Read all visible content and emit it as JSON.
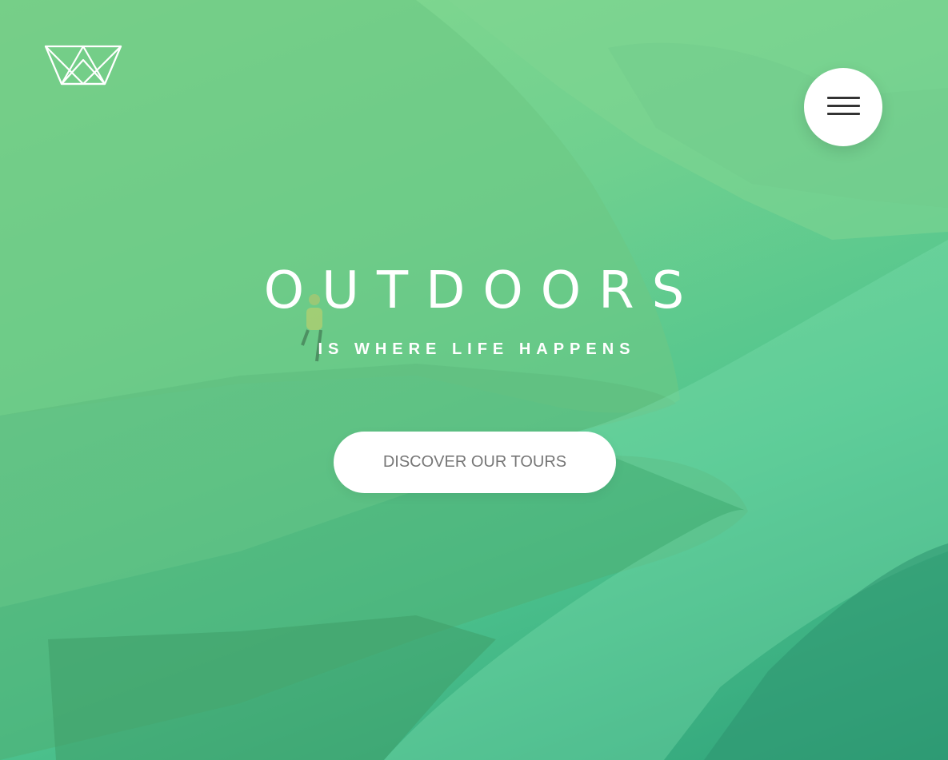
{
  "header": {
    "logo_icon": "crown-icon",
    "menu_icon": "hamburger-menu-icon"
  },
  "hero": {
    "title": "OUTDOORS",
    "subtitle": "IS WHERE LIFE HAPPENS",
    "cta_label": "DISCOVER OUR TOURS"
  },
  "colors": {
    "overlay_top": "#86d98f",
    "overlay_bottom": "#2fa37a",
    "text": "#ffffff",
    "button_bg": "#ffffff",
    "button_text": "#777777",
    "menu_bar": "#333333"
  }
}
